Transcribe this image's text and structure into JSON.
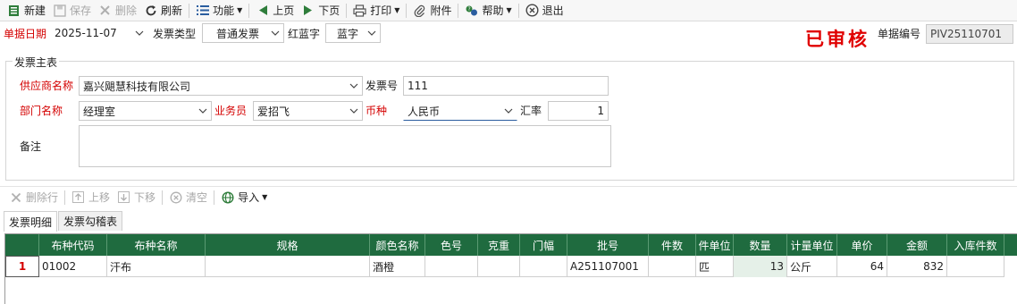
{
  "toolbar": {
    "new": "新建",
    "save": "保存",
    "delete": "删除",
    "refresh": "刷新",
    "function": "功能",
    "prev_page": "上页",
    "next_page": "下页",
    "print": "打印",
    "attachment": "附件",
    "help": "帮助",
    "exit": "退出"
  },
  "header": {
    "date_label": "单据日期",
    "date_value": "2025-11-07",
    "invoice_type_label": "发票类型",
    "invoice_type_value": "普通发票",
    "red_blue_label": "红蓝字",
    "red_blue_value": "蓝字",
    "status_stamp": "已审核",
    "doc_no_label": "单据编号",
    "doc_no_value": "PIV25110701"
  },
  "main": {
    "group_title": "发票主表",
    "supplier_label": "供应商名称",
    "supplier_value": "嘉兴飓慧科技有限公司",
    "invoice_no_label": "发票号",
    "invoice_no_value": "111",
    "dept_label": "部门名称",
    "dept_value": "经理室",
    "salesman_label": "业务员",
    "salesman_value": "爱招飞",
    "currency_label": "币种",
    "currency_value": "人民币",
    "rate_label": "汇率",
    "rate_value": "1",
    "remark_label": "备注",
    "remark_value": ""
  },
  "detail_toolbar": {
    "delete_row": "删除行",
    "move_up": "上移",
    "move_down": "下移",
    "clear": "清空",
    "import": "导入"
  },
  "tabs": [
    "发票明细",
    "发票勾稽表"
  ],
  "grid": {
    "columns": [
      "布种代码",
      "布种名称",
      "规格",
      "颜色名称",
      "色号",
      "克重",
      "门幅",
      "批号",
      "件数",
      "件单位",
      "数量",
      "计量单位",
      "单价",
      "金额",
      "入库件数"
    ],
    "rows": [
      {
        "index": "1",
        "cells": [
          "01002",
          "汗布",
          "",
          "酒橙",
          "",
          "",
          "",
          "A251107001",
          "",
          "匹",
          "13",
          "公斤",
          "64",
          "832",
          ""
        ]
      }
    ]
  },
  "colors": {
    "required_label": "#d40000",
    "grid_header": "#1f6b3f",
    "stamp": "#e00000"
  }
}
